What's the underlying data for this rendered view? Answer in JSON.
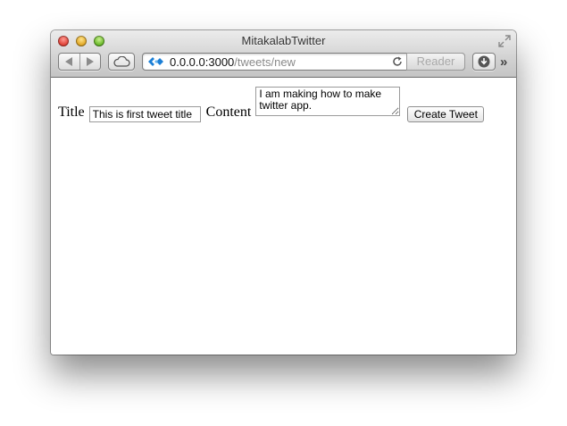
{
  "window": {
    "title": "MitakalabTwitter"
  },
  "toolbar": {
    "back_icon": "back-arrow-icon",
    "forward_icon": "forward-arrow-icon",
    "icloud_icon": "cloud-icon",
    "address": {
      "host": "0.0.0.0:3000",
      "path": "/tweets/new"
    },
    "reader_label": "Reader",
    "download_icon": "download-icon",
    "more_label": "»"
  },
  "form": {
    "title_label": "Title",
    "title_value": "This is first tweet title",
    "content_label": "Content",
    "content_value": "I am making how to make twitter app.",
    "submit_label": "Create Tweet"
  },
  "colors": {
    "close": "#e0443a",
    "minimize": "#e2a928",
    "maximize": "#6cba2c",
    "site_icon": "#1b7fd6"
  }
}
